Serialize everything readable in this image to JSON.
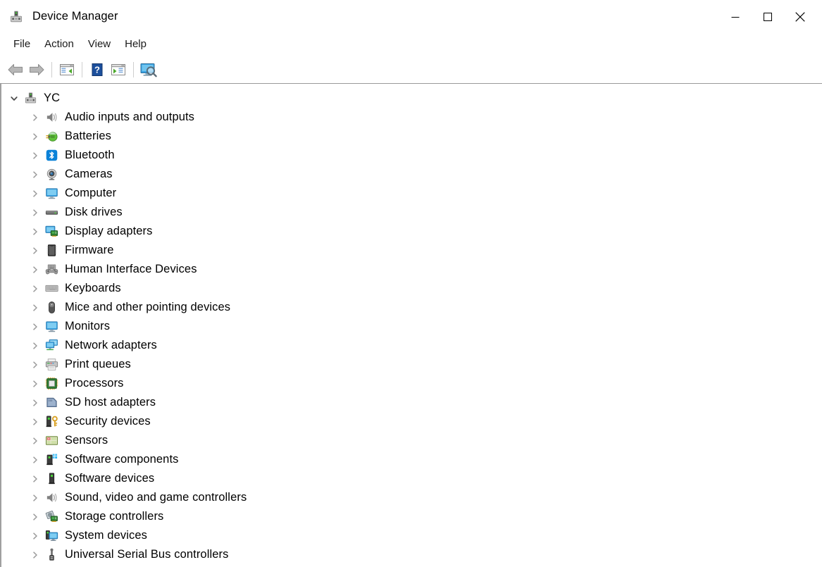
{
  "window": {
    "title": "Device Manager",
    "icon": "device-manager-icon",
    "controls": [
      {
        "name": "minimize-button",
        "glyph": "minimize"
      },
      {
        "name": "maximize-button",
        "glyph": "maximize"
      },
      {
        "name": "close-button",
        "glyph": "close"
      }
    ]
  },
  "menubar": {
    "items": [
      {
        "label": "File"
      },
      {
        "label": "Action"
      },
      {
        "label": "View"
      },
      {
        "label": "Help"
      }
    ]
  },
  "toolbar": {
    "buttons": [
      {
        "name": "back-button",
        "icon": "back-arrow-icon"
      },
      {
        "name": "forward-button",
        "icon": "forward-arrow-icon"
      },
      {
        "name": "separator-1",
        "icon": "separator"
      },
      {
        "name": "properties-button",
        "icon": "properties-icon"
      },
      {
        "name": "separator-2",
        "icon": "separator"
      },
      {
        "name": "help-button",
        "icon": "help-icon"
      },
      {
        "name": "update-driver-button",
        "icon": "update-driver-icon"
      },
      {
        "name": "separator-3",
        "icon": "separator"
      },
      {
        "name": "scan-hardware-changes-button",
        "icon": "scan-hardware-icon"
      }
    ]
  },
  "tree": {
    "root": {
      "label": "YC",
      "icon": "computer-node-icon",
      "expanded": true,
      "twisty": "chevron-down-icon"
    },
    "nodes": [
      {
        "label": "Audio inputs and outputs",
        "icon": "speaker-icon"
      },
      {
        "label": "Batteries",
        "icon": "battery-icon"
      },
      {
        "label": "Bluetooth",
        "icon": "bluetooth-icon"
      },
      {
        "label": "Cameras",
        "icon": "camera-icon"
      },
      {
        "label": "Computer",
        "icon": "monitor-icon"
      },
      {
        "label": "Disk drives",
        "icon": "disk-drive-icon"
      },
      {
        "label": "Display adapters",
        "icon": "display-adapter-icon"
      },
      {
        "label": "Firmware",
        "icon": "firmware-chip-icon"
      },
      {
        "label": "Human Interface Devices",
        "icon": "gamepad-icon"
      },
      {
        "label": "Keyboards",
        "icon": "keyboard-icon"
      },
      {
        "label": "Mice and other pointing devices",
        "icon": "mouse-icon"
      },
      {
        "label": "Monitors",
        "icon": "monitor-icon"
      },
      {
        "label": "Network adapters",
        "icon": "network-adapter-icon"
      },
      {
        "label": "Print queues",
        "icon": "printer-icon"
      },
      {
        "label": "Processors",
        "icon": "processor-icon"
      },
      {
        "label": "SD host adapters",
        "icon": "sd-card-icon"
      },
      {
        "label": "Security devices",
        "icon": "security-key-icon"
      },
      {
        "label": "Sensors",
        "icon": "sensor-icon"
      },
      {
        "label": "Software components",
        "icon": "software-component-icon"
      },
      {
        "label": "Software devices",
        "icon": "software-device-icon"
      },
      {
        "label": "Sound, video and game controllers",
        "icon": "speaker-icon"
      },
      {
        "label": "Storage controllers",
        "icon": "storage-controller-icon"
      },
      {
        "label": "System devices",
        "icon": "system-device-icon"
      },
      {
        "label": "Universal Serial Bus controllers",
        "icon": "usb-icon"
      }
    ],
    "child_twisty": "chevron-right-icon"
  },
  "colors": {
    "window_bg": "#ffffff",
    "text": "#000000",
    "menu_text": "#1a1a1a",
    "toolbar_border": "#9a9a9a",
    "pane_border": "#a0a0a0",
    "twisty": "#868686",
    "accent_blue": "#2f9fe0",
    "green": "#5aa832",
    "bluetooth_blue": "#0b82d8"
  }
}
